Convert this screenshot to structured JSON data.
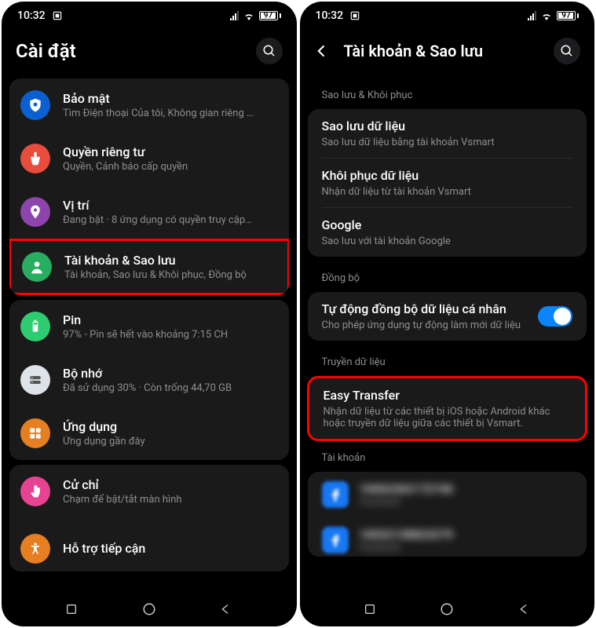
{
  "status": {
    "time": "10:32",
    "battery": "97"
  },
  "left": {
    "title": "Cài đặt",
    "items": [
      {
        "icon": "shield",
        "color": "#0a60d1",
        "title": "Bảo mật",
        "sub": "Tìm Điện thoại Của tôi, Không gian riêng …"
      },
      {
        "icon": "hand",
        "color": "#e74c3c",
        "title": "Quyền riêng tư",
        "sub": "Quyền, Cảnh báo cấp quyền"
      },
      {
        "icon": "location",
        "color": "#8e44ad",
        "title": "Vị trí",
        "sub": "Đang bật · 8 ứng dụng có quyền truy cập…"
      },
      {
        "icon": "person",
        "color": "#27ae60",
        "title": "Tài khoản & Sao lưu",
        "sub": "Tài khoản, Sao lưu & Khôi phục, Đồng bộ",
        "highlight": true
      },
      {
        "icon": "battery",
        "color": "#2ecc71",
        "title": "Pin",
        "sub": "97% - Pin sẽ hết vào khoảng 7:15 CH"
      },
      {
        "icon": "storage",
        "color": "#ecf0f1",
        "title": "Bộ nhớ",
        "sub": "Đã sử dụng 30% · Còn trống 44,70 GB"
      },
      {
        "icon": "apps",
        "color": "#e67e22",
        "title": "Ứng dụng",
        "sub": "Ứng dụng gần đây"
      },
      {
        "icon": "gesture",
        "color": "#e84393",
        "title": "Cử chỉ",
        "sub": "Chạm để bật/tắt màn hình"
      },
      {
        "icon": "accessibility",
        "color": "#e67e22",
        "title": "Hỗ trợ tiếp cận",
        "sub": ""
      }
    ]
  },
  "right": {
    "title": "Tài khoản & Sao lưu",
    "section1": {
      "header": "Sao lưu & Khôi phục",
      "items": [
        {
          "title": "Sao lưu dữ liệu",
          "sub": "Sao lưu dữ liệu bằng tài khoản Vsmart"
        },
        {
          "title": "Khôi phục dữ liệu",
          "sub": "Nhận dữ liệu từ tài khoản Vsmart"
        },
        {
          "title": "Google",
          "sub": "Sao lưu với tài khoản Google"
        }
      ]
    },
    "section2": {
      "header": "Đồng bộ",
      "item": {
        "title": "Tự động đồng bộ dữ liệu cá nhân",
        "sub": "Cho phép ứng dụng tự động làm mới dữ liệu"
      }
    },
    "section3": {
      "header": "Truyền dữ liệu",
      "item": {
        "title": "Easy Transfer",
        "sub": "Nhận dữ liệu từ các thiết bị iOS hoặc Android khác hoặc truyền dữ liệu giữa các thiết bị Vsmart."
      }
    },
    "section4": {
      "header": "Tài khoản",
      "accounts": [
        {
          "title": "10002302172740",
          "sub": "Facebook"
        },
        {
          "title": "10032138823279",
          "sub": "Facebook"
        }
      ]
    }
  }
}
